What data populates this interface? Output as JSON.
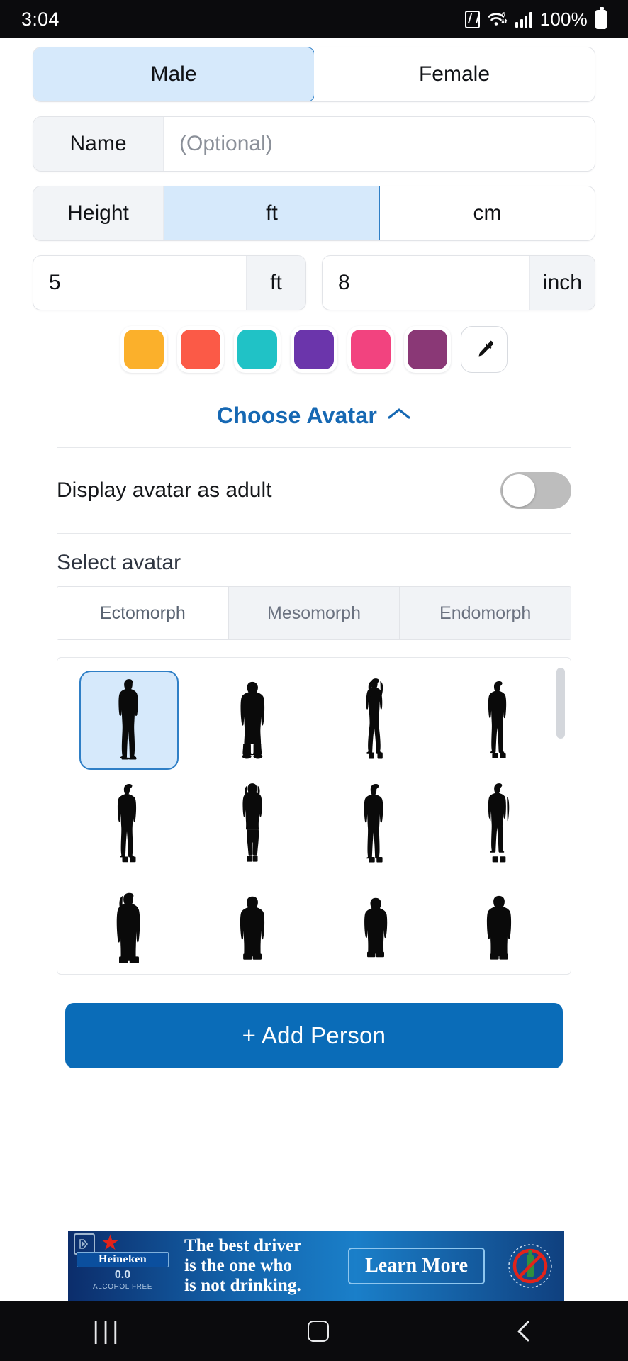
{
  "status_bar": {
    "time": "3:04",
    "battery_percent": "100%",
    "icons": [
      "nfc-icon",
      "wifi-icon",
      "signal-icon",
      "battery-icon"
    ]
  },
  "form": {
    "gender": {
      "options": [
        "Male",
        "Female"
      ],
      "selected": "Male"
    },
    "name": {
      "label": "Name",
      "placeholder": "(Optional)",
      "value": ""
    },
    "height": {
      "label": "Height",
      "units": [
        "ft",
        "cm"
      ],
      "selected_unit": "ft",
      "feet_value": "5",
      "feet_unit": "ft",
      "inch_value": "8",
      "inch_unit": "inch"
    },
    "colors": {
      "swatches": [
        "#fbb02b",
        "#fb5a47",
        "#20c2c6",
        "#6b35ab",
        "#f2437f",
        "#8a3876"
      ],
      "picker_icon": "eyedropper-icon"
    }
  },
  "avatar_section": {
    "toggle_link": {
      "label": "Choose Avatar",
      "icon": "chevron-up-icon"
    },
    "adult_toggle": {
      "label": "Display avatar as adult",
      "state": "off"
    },
    "select_title": "Select avatar",
    "tabs": [
      {
        "label": "Ectomorph",
        "active": true
      },
      {
        "label": "Mesomorph",
        "active": false
      },
      {
        "label": "Endomorph",
        "active": false
      }
    ],
    "avatars": [
      {
        "name": "avatar-man-suit-hands-in-pockets",
        "type": "male-slim",
        "selected": true
      },
      {
        "name": "avatar-boy-hoodie",
        "type": "male-young",
        "selected": false
      },
      {
        "name": "avatar-woman-long-hair",
        "type": "female-slim",
        "selected": false
      },
      {
        "name": "avatar-man-standing",
        "type": "male-slim-2",
        "selected": false
      },
      {
        "name": "avatar-man-tshirt",
        "type": "male-tshirt",
        "selected": false
      },
      {
        "name": "avatar-woman-dress",
        "type": "female-dress",
        "selected": false
      },
      {
        "name": "avatar-man-arms-down",
        "type": "male-arms-down",
        "selected": false
      },
      {
        "name": "avatar-man-jacket",
        "type": "male-jacket",
        "selected": false
      },
      {
        "name": "avatar-woman-coat",
        "type": "female-coat",
        "selected": false
      },
      {
        "name": "avatar-child-short",
        "type": "child-1",
        "selected": false
      },
      {
        "name": "avatar-child-jacket",
        "type": "child-2",
        "selected": false
      },
      {
        "name": "avatar-child-standing",
        "type": "child-3",
        "selected": false
      }
    ]
  },
  "actions": {
    "add_person": "+ Add Person"
  },
  "ad": {
    "brand": "Heineken",
    "brand_sub": "0.0",
    "brand_tag": "ALCOHOL FREE",
    "headline_line1": "The best driver",
    "headline_line2": "is the one who",
    "headline_line3": "is not drinking.",
    "cta": "Learn More",
    "badge_icon": "ad-choices-icon",
    "right_icon": "no-drink-driving-icon"
  },
  "nav_bar": {
    "recents": "recents-icon",
    "home": "home-icon",
    "back": "back-icon"
  },
  "theme": {
    "accent_blue": "#0a6cb8",
    "link_blue": "#1668b3",
    "selected_fill": "#d6e9fb",
    "selected_border": "#2f7fc6"
  }
}
